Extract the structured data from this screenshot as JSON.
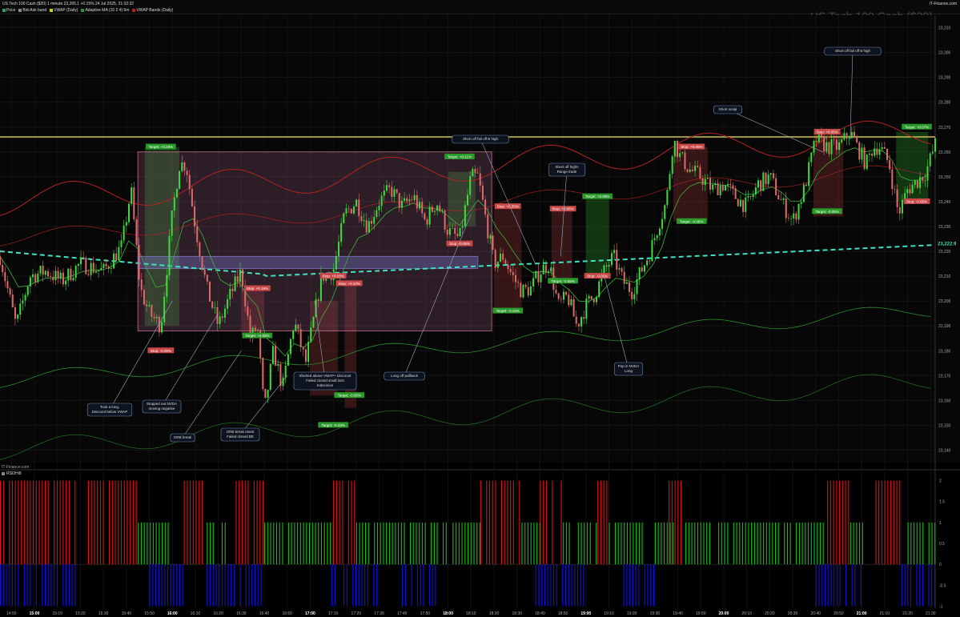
{
  "header": {
    "title": "US Tech 100 Cash ($20) 1 minute 23,265.1 +0.15% 24 Jul 2025, 21:32:32",
    "legend": [
      {
        "label": "Price",
        "color": "#26a65b"
      },
      {
        "label": "Bid-Ask band",
        "color": "#888888"
      },
      {
        "label": "VWAP (Daily)",
        "color": "#d4d400"
      },
      {
        "label": "Adaptive MA (10 2 4) 6m",
        "color": "#2e8b2e"
      },
      {
        "label": "VWAP Bands (Daily)",
        "color": "#b22222"
      }
    ],
    "brand": "IT-Finance.com"
  },
  "watermark": "US Tech 100 Cash ($20)",
  "credit": "IT-Finance.com",
  "rsi_label": "RSI2Hi8",
  "colors": {
    "up_candle": "#3ddc3d",
    "down_candle": "#e06a6a",
    "vwap": "#40e0c0",
    "band": "#b22222",
    "ama": "#2e8b2e",
    "rsi_red": "#e01010",
    "rsi_green": "#10c010",
    "rsi_blue": "#1010e0"
  },
  "chart_data": {
    "type": "candlestick",
    "y_ticks": [
      "23,310",
      "23,300",
      "23,290",
      "23,280",
      "23,270",
      "23,260",
      "23,250",
      "23,240",
      "23,230",
      "23,220",
      "23,210",
      "23,200",
      "23,190",
      "23,180",
      "23,170",
      "23,160",
      "23,150",
      "23,140"
    ],
    "x_ticks": [
      "14:50",
      "15:00",
      "15:10",
      "15:20",
      "15:30",
      "15:40",
      "15:50",
      "16:00",
      "16:10",
      "16:20",
      "16:30",
      "16:40",
      "16:50",
      "17:00",
      "17:10",
      "17:20",
      "17:30",
      "17:40",
      "17:50",
      "18:00",
      "18:10",
      "18:20",
      "18:30",
      "18:40",
      "18:50",
      "19:00",
      "19:10",
      "19:20",
      "19:30",
      "19:40",
      "19:50",
      "20:00",
      "20:10",
      "20:20",
      "20:30",
      "20:40",
      "20:50",
      "21:00",
      "21:10",
      "21:20",
      "21:30"
    ],
    "bold_ticks": [
      "15:00",
      "16:00",
      "17:00",
      "18:00",
      "19:00",
      "20:00",
      "21:00"
    ],
    "ylim": [
      23135,
      23315
    ],
    "xlim_minutes": [
      885,
      1292
    ],
    "price_path": [
      [
        885,
        23218
      ],
      [
        892,
        23190
      ],
      [
        898,
        23210
      ],
      [
        905,
        23212
      ],
      [
        912,
        23208
      ],
      [
        920,
        23215
      ],
      [
        930,
        23212
      ],
      [
        938,
        23222
      ],
      [
        942,
        23245
      ],
      [
        946,
        23205
      ],
      [
        950,
        23195
      ],
      [
        955,
        23190
      ],
      [
        960,
        23235
      ],
      [
        963,
        23255
      ],
      [
        966,
        23255
      ],
      [
        970,
        23230
      ],
      [
        975,
        23205
      ],
      [
        980,
        23190
      ],
      [
        985,
        23202
      ],
      [
        990,
        23212
      ],
      [
        994,
        23185
      ],
      [
        997,
        23190
      ],
      [
        1000,
        23155
      ],
      [
        1004,
        23180
      ],
      [
        1008,
        23165
      ],
      [
        1013,
        23192
      ],
      [
        1018,
        23175
      ],
      [
        1022,
        23195
      ],
      [
        1025,
        23210
      ],
      [
        1030,
        23212
      ],
      [
        1035,
        23235
      ],
      [
        1040,
        23240
      ],
      [
        1045,
        23230
      ],
      [
        1050,
        23240
      ],
      [
        1055,
        23245
      ],
      [
        1060,
        23238
      ],
      [
        1065,
        23242
      ],
      [
        1070,
        23232
      ],
      [
        1075,
        23240
      ],
      [
        1080,
        23228
      ],
      [
        1085,
        23225
      ],
      [
        1090,
        23250
      ],
      [
        1093,
        23250
      ],
      [
        1096,
        23235
      ],
      [
        1100,
        23215
      ],
      [
        1104,
        23218
      ],
      [
        1108,
        23210
      ],
      [
        1112,
        23204
      ],
      [
        1116,
        23205
      ],
      [
        1120,
        23212
      ],
      [
        1124,
        23215
      ],
      [
        1128,
        23198
      ],
      [
        1132,
        23202
      ],
      [
        1136,
        23190
      ],
      [
        1140,
        23198
      ],
      [
        1144,
        23203
      ],
      [
        1148,
        23212
      ],
      [
        1152,
        23218
      ],
      [
        1156,
        23208
      ],
      [
        1160,
        23204
      ],
      [
        1164,
        23212
      ],
      [
        1168,
        23220
      ],
      [
        1172,
        23232
      ],
      [
        1175,
        23240
      ],
      [
        1178,
        23265
      ],
      [
        1181,
        23258
      ],
      [
        1185,
        23253
      ],
      [
        1190,
        23250
      ],
      [
        1195,
        23245
      ],
      [
        1200,
        23247
      ],
      [
        1205,
        23242
      ],
      [
        1210,
        23238
      ],
      [
        1215,
        23247
      ],
      [
        1220,
        23250
      ],
      [
        1225,
        23240
      ],
      [
        1230,
        23232
      ],
      [
        1235,
        23245
      ],
      [
        1240,
        23265
      ],
      [
        1245,
        23262
      ],
      [
        1250,
        23262
      ],
      [
        1255,
        23268
      ],
      [
        1258,
        23262
      ],
      [
        1262,
        23255
      ],
      [
        1265,
        23262
      ],
      [
        1268,
        23262
      ],
      [
        1272,
        23255
      ],
      [
        1276,
        23235
      ],
      [
        1280,
        23245
      ],
      [
        1284,
        23248
      ],
      [
        1288,
        23252
      ],
      [
        1292,
        23263
      ]
    ],
    "vwap_label": "23,222.9",
    "trades": [
      {
        "side": "long",
        "target": "Target: +0.29%",
        "stop": "Stop: -0.09%"
      },
      {
        "side": "short",
        "target": "Target: +0.08%",
        "stop": "Stop: +0.19%"
      },
      {
        "side": "short",
        "target": "Target: -0.23%",
        "stop": "Stop: +0.03%"
      },
      {
        "side": "short",
        "target": "Target: -0.05%",
        "stop": "Stop: +0.10%"
      },
      {
        "side": "long",
        "target": "Target: +0.11%",
        "stop": "Stop: -0.05%"
      },
      {
        "side": "short",
        "target": "Target: -0.10%",
        "stop": "Stop: +0.05%"
      },
      {
        "side": "short",
        "target": "Target: -0.05%",
        "stop": "Stop: +0.05%"
      },
      {
        "side": "long",
        "target": "Target: +0.06%",
        "stop": "Stop: -0.05%"
      },
      {
        "side": "short",
        "target": "Target: -0.05%",
        "stop": "Stop: +0.05%"
      },
      {
        "side": "short",
        "target": "Target: -0.05%",
        "stop": "Stop: +0.05%"
      },
      {
        "side": "long",
        "target": "Target: +0.07%",
        "stop": "Stop: -0.05%"
      }
    ],
    "annotations": [
      "Took a long,\nDiscount below VWAP",
      "Stopped out NVDA\nmoving negative",
      "ORB break",
      "ORB break retest\nFailed closed BE",
      "Shorted above VWAP+ Discount\nFailed closed small loss\nIndecision",
      "Long off pullback",
      "Short off fail off B high",
      "Short off highs\nRange trade",
      "Pop in NVDA\nLong",
      "Short scalp",
      "Short off fail off B high"
    ],
    "rsi_ticks": [
      "2",
      "1.5",
      "1",
      "0.5",
      "0",
      "-0.5",
      "-1"
    ],
    "rsi_ylim": [
      -1.05,
      2.05
    ],
    "rsi_segments": [
      [
        "red",
        885,
        918
      ],
      [
        "blue",
        885,
        918
      ],
      [
        "red",
        922,
        945
      ],
      [
        "green",
        945,
        960
      ],
      [
        "blue",
        950,
        965
      ],
      [
        "red",
        965,
        975
      ],
      [
        "green",
        975,
        983
      ],
      [
        "red",
        985,
        1000
      ],
      [
        "blue",
        975,
        1000
      ],
      [
        "green",
        1000,
        1030
      ],
      [
        "red",
        1030,
        1040
      ],
      [
        "blue",
        1028,
        1050
      ],
      [
        "green",
        1040,
        1080
      ],
      [
        "blue",
        1060,
        1075
      ],
      [
        "green",
        1082,
        1094
      ],
      [
        "red",
        1094,
        1112
      ],
      [
        "green",
        1112,
        1120
      ],
      [
        "red",
        1120,
        1130
      ],
      [
        "blue",
        1118,
        1140
      ],
      [
        "green",
        1130,
        1145
      ],
      [
        "red",
        1145,
        1150
      ],
      [
        "green",
        1150,
        1168
      ],
      [
        "blue",
        1155,
        1170
      ],
      [
        "green",
        1170,
        1178
      ],
      [
        "red",
        1176,
        1182
      ],
      [
        "green",
        1182,
        1245
      ],
      [
        "blue",
        1240,
        1260
      ],
      [
        "red",
        1245,
        1255
      ],
      [
        "green",
        1255,
        1262
      ],
      [
        "red",
        1266,
        1277
      ],
      [
        "green",
        1280,
        1292
      ],
      [
        "blue",
        1276,
        1292
      ]
    ]
  }
}
